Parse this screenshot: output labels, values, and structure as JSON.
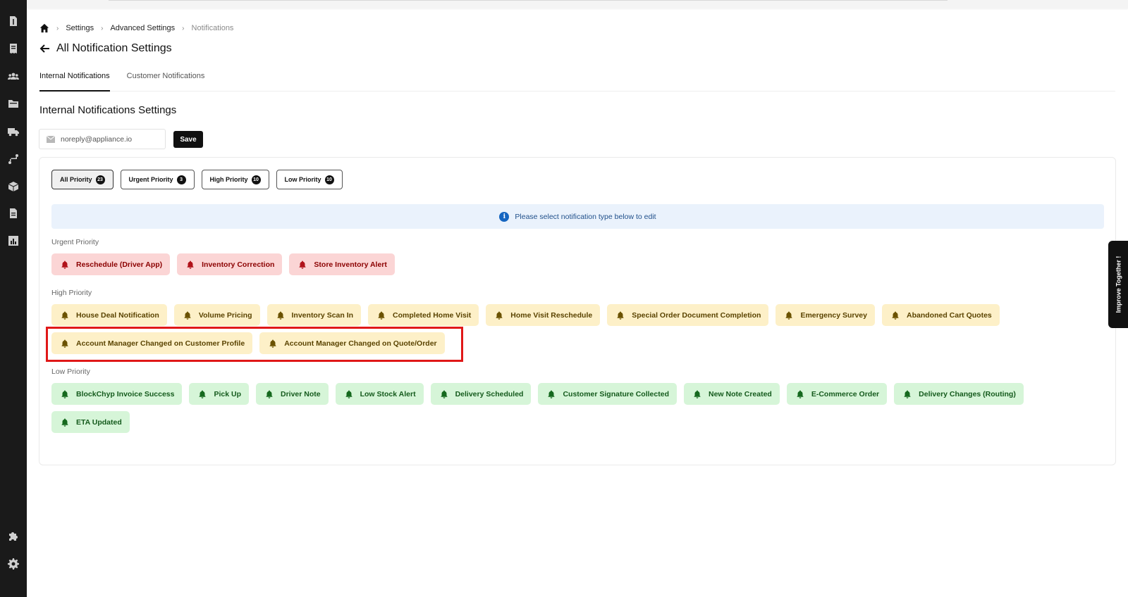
{
  "sidebar": {
    "items": [
      {
        "name": "sidebar-item-invoices",
        "icon": "dollar-document-icon"
      },
      {
        "name": "sidebar-item-orders",
        "icon": "receipt-icon"
      },
      {
        "name": "sidebar-item-customers",
        "icon": "people-icon"
      },
      {
        "name": "sidebar-item-files",
        "icon": "folder-icon"
      },
      {
        "name": "sidebar-item-delivery",
        "icon": "truck-icon"
      },
      {
        "name": "sidebar-item-routing",
        "icon": "route-icon"
      },
      {
        "name": "sidebar-item-inventory",
        "icon": "box-icon"
      },
      {
        "name": "sidebar-item-documents",
        "icon": "document-icon"
      },
      {
        "name": "sidebar-item-reports",
        "icon": "chart-icon"
      },
      {
        "name": "sidebar-item-integrations",
        "icon": "puzzle-icon"
      },
      {
        "name": "sidebar-item-settings",
        "icon": "gear-icon"
      }
    ]
  },
  "breadcrumb": {
    "items": [
      "Settings",
      "Advanced Settings",
      "Notifications"
    ]
  },
  "header": {
    "title": "All Notification Settings"
  },
  "tabs": [
    {
      "label": "Internal Notifications",
      "active": true
    },
    {
      "label": "Customer Notifications",
      "active": false
    }
  ],
  "section": {
    "title": "Internal Notifications Settings"
  },
  "email": {
    "value": "noreply@appliance.io",
    "save_label": "Save"
  },
  "filters": [
    {
      "label": "All Priority",
      "count": "23",
      "active": true
    },
    {
      "label": "Urgent Priority",
      "count": "3",
      "active": false
    },
    {
      "label": "High Priority",
      "count": "10",
      "active": false
    },
    {
      "label": "Low Priority",
      "count": "10",
      "active": false
    }
  ],
  "info_banner": {
    "text": "Please select notification type below to edit"
  },
  "groups": {
    "urgent": {
      "label": "Urgent Priority",
      "items": [
        "Reschedule (Driver App)",
        "Inventory Correction",
        "Store Inventory Alert"
      ]
    },
    "high": {
      "label": "High Priority",
      "items_row1": [
        "House Deal Notification",
        "Volume Pricing",
        "Inventory Scan In",
        "Completed Home Visit",
        "Home Visit Reschedule",
        "Special Order Document Completion",
        "Emergency Survey",
        "Abandoned Cart Quotes"
      ],
      "items_row2": [
        "Account Manager Changed on Customer Profile",
        "Account Manager Changed on Quote/Order"
      ]
    },
    "low": {
      "label": "Low Priority",
      "items_row1": [
        "BlockChyp Invoice Success",
        "Pick Up",
        "Driver Note",
        "Low Stock Alert",
        "Delivery Scheduled",
        "Customer Signature Collected",
        "New Note Created",
        "E-Commerce Order",
        "Delivery Changes (Routing)"
      ],
      "items_row2": [
        "ETA Updated"
      ]
    }
  },
  "improve_tab": {
    "label": "Improve Together !"
  },
  "colors": {
    "urgent_bg": "#fbd5d5",
    "high_bg": "#fdf0c8",
    "low_bg": "#d6f5d8",
    "highlight": "#e01818"
  }
}
